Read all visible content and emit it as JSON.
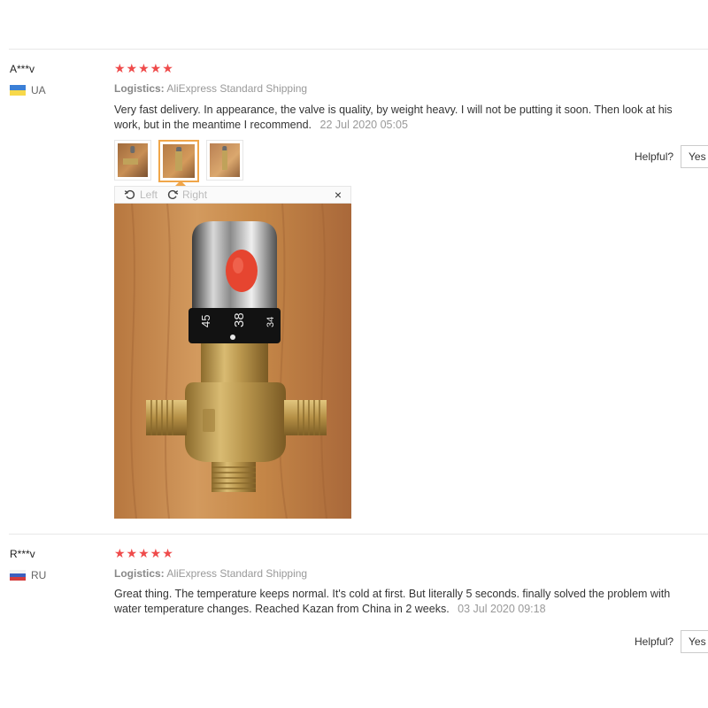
{
  "reviews": [
    {
      "user": "A***v",
      "country_code": "UA",
      "flag": "ukraine-flag",
      "rating_stars": "★★★★★",
      "rating": 5,
      "logistics_label": "Logistics:",
      "logistics_value": "AliExpress Standard Shipping",
      "text": "Very fast delivery. In appearance, the valve is quality, by weight heavy. I will not be putting it soon. Then look at his work, but in the meantime I recommend.",
      "date": "22 Jul 2020 05:05",
      "helpful_label": "Helpful?",
      "yes_label": "Yes",
      "viewer": {
        "left_label": "Left",
        "right_label": "Right",
        "close_label": "×"
      },
      "photo_dial_numbers": [
        "45",
        "38",
        "34"
      ]
    },
    {
      "user": "R***v",
      "country_code": "RU",
      "flag": "russia-flag",
      "rating_stars": "★★★★★",
      "rating": 5,
      "logistics_label": "Logistics:",
      "logistics_value": "AliExpress Standard Shipping",
      "text": "Great thing. The temperature keeps normal. It's cold at first. But literally 5 seconds. finally solved the problem with water temperature changes. Reached Kazan from China in 2 weeks.",
      "date": "03 Jul 2020 09:18",
      "helpful_label": "Helpful?",
      "yes_label": "Yes"
    }
  ],
  "colors": {
    "star": "#ef4b4b",
    "active_thumb_border": "#f0a64a"
  }
}
